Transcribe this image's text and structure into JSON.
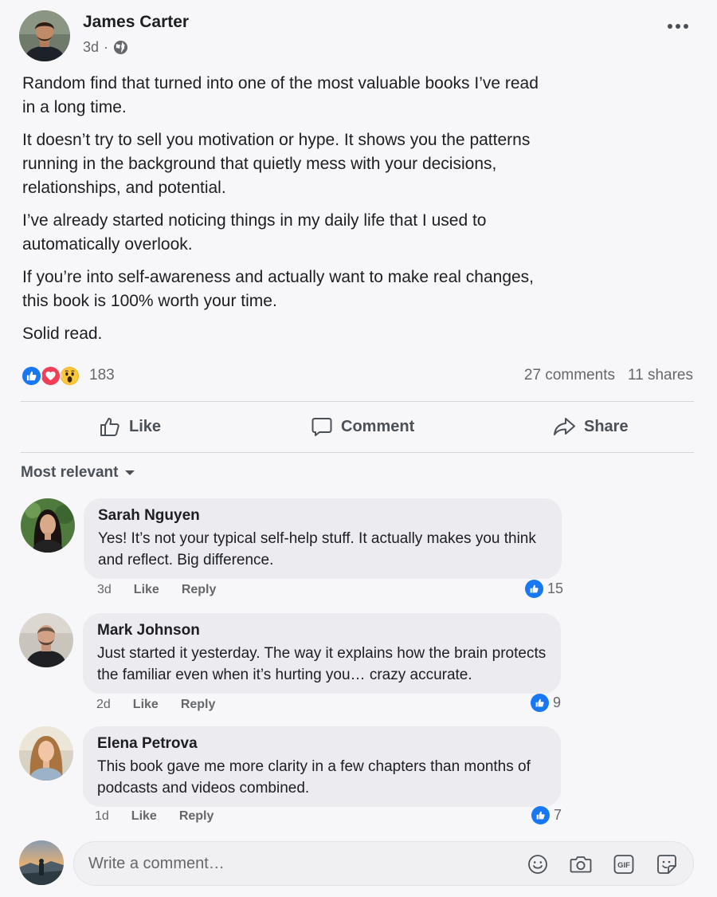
{
  "post": {
    "author": "James Carter",
    "time": "3d",
    "separator": "·",
    "audience_icon": "globe-icon",
    "paragraphs": [
      "Random find that turned into one of the most valuable books I’ve read in a long time.",
      "It doesn’t try to sell you motivation or hype. It shows you the patterns running in the background that quietly mess with your decisions, relationships, and potential.",
      "I’ve already started noticing things in my daily life that I used to automatically overlook.",
      "If you’re into self-awareness and actually want to make real changes, this book is 100% worth your time.",
      "Solid read."
    ]
  },
  "stats": {
    "reactions": [
      "like",
      "love",
      "wow"
    ],
    "reaction_count": "183",
    "comments": "27 comments",
    "shares": "11 shares"
  },
  "actions": {
    "like": "Like",
    "comment": "Comment",
    "share": "Share"
  },
  "sort": {
    "label": "Most relevant"
  },
  "comments": [
    {
      "name": "Sarah Nguyen",
      "text": "Yes! It’s not your typical self-help stuff. It actually makes you think and reflect. Big difference.",
      "time": "3d",
      "like": "Like",
      "reply": "Reply",
      "likes": "15"
    },
    {
      "name": "Mark Johnson",
      "text": "Just started it yesterday. The way it explains how the brain protects the familiar even when it’s hurting you… crazy accurate.",
      "time": "2d",
      "like": "Like",
      "reply": "Reply",
      "likes": "9"
    },
    {
      "name": "Elena Petrova",
      "text": "This book gave me more clarity in a few chapters than months of podcasts and videos combined.",
      "time": "1d",
      "like": "Like",
      "reply": "Reply",
      "likes": "7"
    }
  ],
  "composer": {
    "placeholder": "Write a comment…",
    "icons": [
      "emoji-icon",
      "camera-icon",
      "gif-icon",
      "sticker-icon"
    ]
  },
  "colors": {
    "accent": "#1877f2",
    "love": "#f33e58",
    "wow": "#f7b125",
    "muted_text": "#65676b",
    "bubble": "#ececf0"
  }
}
